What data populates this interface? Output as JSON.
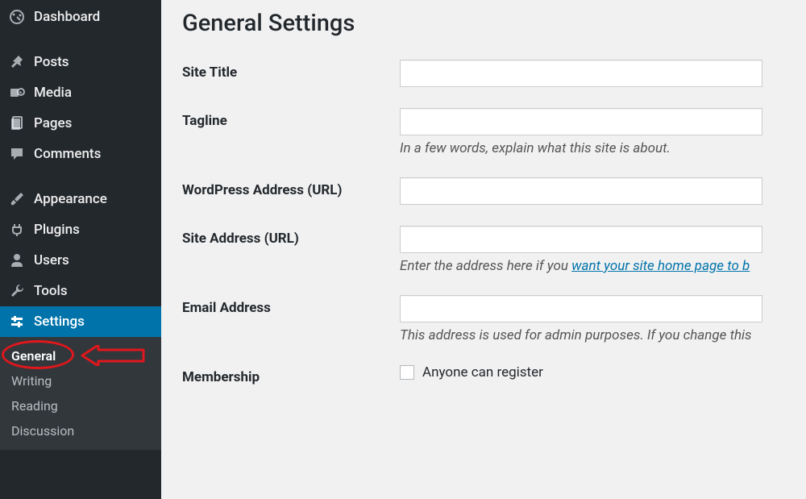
{
  "sidebar": {
    "items": [
      {
        "label": "Dashboard",
        "icon": "dashboard-icon"
      },
      {
        "label": "Posts",
        "icon": "pin-icon"
      },
      {
        "label": "Media",
        "icon": "media-icon"
      },
      {
        "label": "Pages",
        "icon": "pages-icon"
      },
      {
        "label": "Comments",
        "icon": "comments-icon"
      },
      {
        "label": "Appearance",
        "icon": "brush-icon"
      },
      {
        "label": "Plugins",
        "icon": "plug-icon"
      },
      {
        "label": "Users",
        "icon": "users-icon"
      },
      {
        "label": "Tools",
        "icon": "wrench-icon"
      },
      {
        "label": "Settings",
        "icon": "settings-icon"
      }
    ],
    "submenu": {
      "items": [
        {
          "label": "General"
        },
        {
          "label": "Writing"
        },
        {
          "label": "Reading"
        },
        {
          "label": "Discussion"
        }
      ]
    }
  },
  "page": {
    "title": "General Settings"
  },
  "form": {
    "site_title": {
      "label": "Site Title",
      "value": ""
    },
    "tagline": {
      "label": "Tagline",
      "value": "",
      "description": "In a few words, explain what this site is about."
    },
    "wp_url": {
      "label": "WordPress Address (URL)",
      "value": ""
    },
    "site_url": {
      "label": "Site Address (URL)",
      "value": "",
      "description_prefix": "Enter the address here if you ",
      "description_link": "want your site home page to b"
    },
    "email": {
      "label": "Email Address",
      "value": "",
      "description": "This address is used for admin purposes. If you change this"
    },
    "membership": {
      "label": "Membership",
      "checkbox_label": "Anyone can register"
    }
  }
}
